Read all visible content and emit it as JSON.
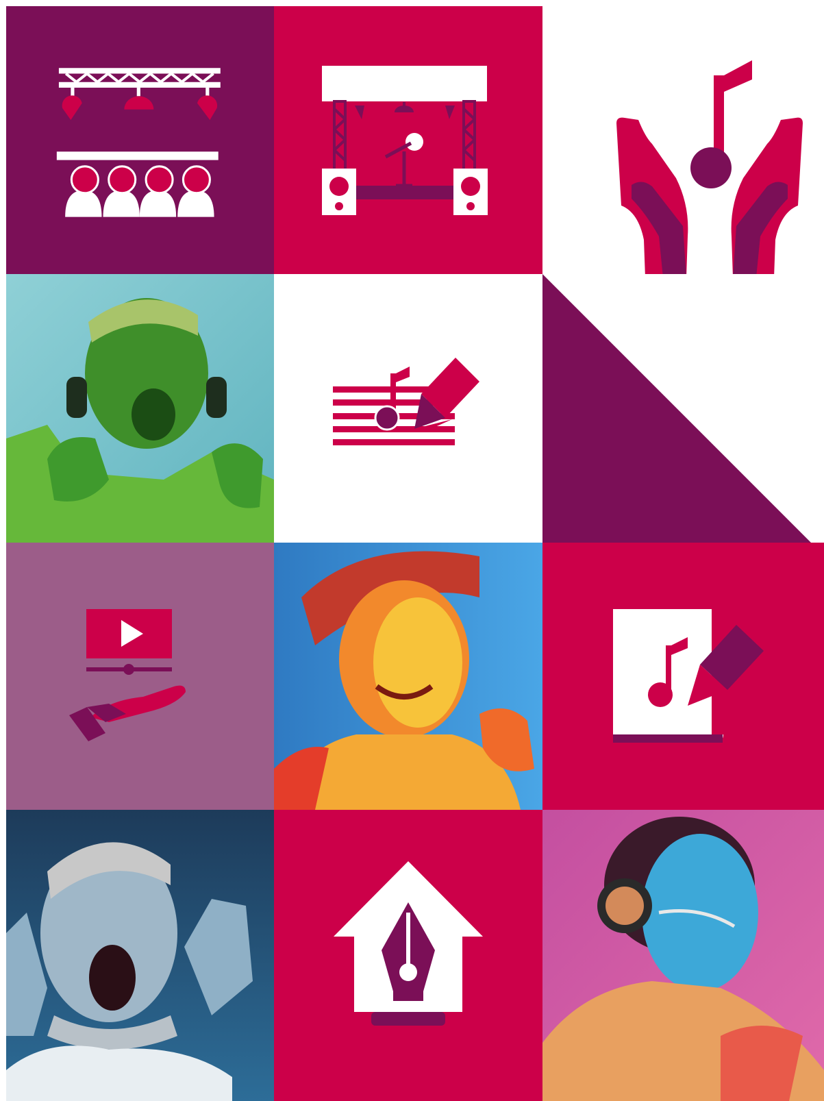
{
  "colors": {
    "plum": "#7b0f57",
    "crimson": "#cc0049",
    "mauve": "#9c5d89",
    "white": "#ffffff"
  },
  "tiles": [
    {
      "row": 1,
      "col": 1,
      "kind": "icon",
      "icon": "concert-stage-audience-icon",
      "bg": "plum"
    },
    {
      "row": 1,
      "col": 2,
      "kind": "icon",
      "icon": "stage-with-microphone-icon",
      "bg": "crimson"
    },
    {
      "row": 1,
      "col": 3,
      "kind": "icon",
      "icon": "hands-holding-music-note-icon",
      "bg": "white"
    },
    {
      "row": 2,
      "col": 1,
      "kind": "photo",
      "icon": "man-with-headphones-photo",
      "bg": "green"
    },
    {
      "row": 2,
      "col": 2,
      "kind": "icon",
      "icon": "music-composing-icon",
      "bg": "white"
    },
    {
      "row": 2,
      "col": 3,
      "kind": "graphic",
      "icon": "diagonal-triangle-graphic",
      "bg": "plum"
    },
    {
      "row": 3,
      "col": 1,
      "kind": "icon",
      "icon": "video-in-hand-icon",
      "bg": "mauve"
    },
    {
      "row": 3,
      "col": 2,
      "kind": "photo",
      "icon": "girl-with-cap-photo",
      "bg": "blue"
    },
    {
      "row": 3,
      "col": 3,
      "kind": "icon",
      "icon": "music-sheet-writing-icon",
      "bg": "crimson"
    },
    {
      "row": 4,
      "col": 1,
      "kind": "photo",
      "icon": "shouting-man-photo",
      "bg": "navy"
    },
    {
      "row": 4,
      "col": 2,
      "kind": "icon",
      "icon": "house-with-pen-nib-icon",
      "bg": "crimson"
    },
    {
      "row": 4,
      "col": 3,
      "kind": "photo",
      "icon": "woman-with-headphones-photo",
      "bg": "pink"
    }
  ]
}
